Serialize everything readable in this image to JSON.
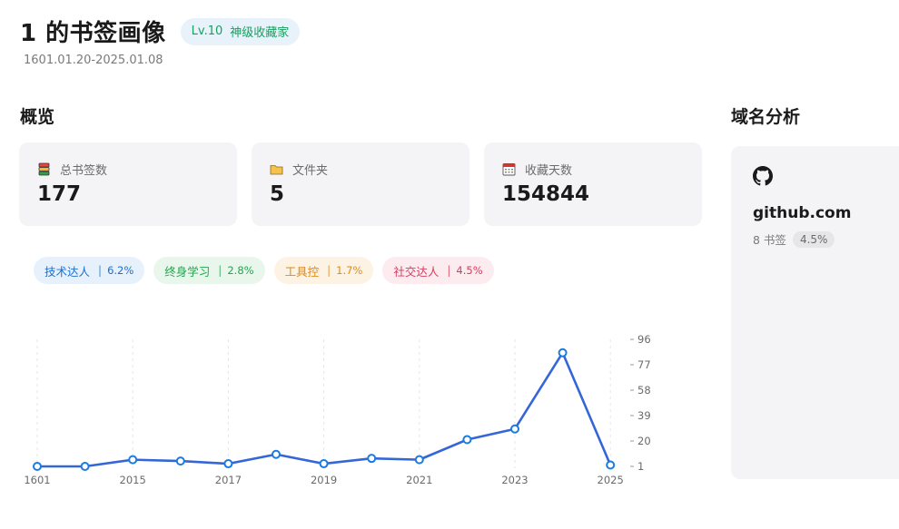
{
  "header": {
    "title": "1 的书签画像",
    "level": "Lv.10",
    "level_title": "神级收藏家",
    "date_range": "1601.01.20-2025.01.08"
  },
  "overview": {
    "title": "概览",
    "cards": [
      {
        "label": "总书签数",
        "value": "177",
        "icon": "bookmark-stack-icon"
      },
      {
        "label": "文件夹",
        "value": "5",
        "icon": "folder-icon"
      },
      {
        "label": "收藏天数",
        "value": "154844",
        "icon": "calendar-icon"
      }
    ]
  },
  "tags": [
    {
      "name": "技术达人",
      "percent": "6.2%",
      "color": "#1a6fd0",
      "bg": "#e7f1fc"
    },
    {
      "name": "终身学习",
      "percent": "2.8%",
      "color": "#25a34e",
      "bg": "#e9f6ec"
    },
    {
      "name": "工具控",
      "percent": "1.7%",
      "color": "#e08a17",
      "bg": "#fdf3e4"
    },
    {
      "name": "社交达人",
      "percent": "4.5%",
      "color": "#d43d5e",
      "bg": "#fcebef"
    }
  ],
  "chart_data": {
    "type": "line",
    "x_tick_labels": [
      "1601",
      "2015",
      "2017",
      "2019",
      "2021",
      "2023",
      "2025"
    ],
    "y_ticks": [
      96,
      77,
      58,
      39,
      20,
      1
    ],
    "ylim": [
      1,
      96
    ],
    "values": [
      1,
      1,
      6,
      5,
      3,
      10,
      3,
      7,
      6,
      21,
      29,
      86,
      2
    ],
    "line_color": "#3566d8",
    "point_fill": "#ffffff",
    "grid": "vertical dashed"
  },
  "domains": {
    "title": "域名分析",
    "items": [
      {
        "domain": "github.com",
        "count_label": "8 书签",
        "percent": "4.5%",
        "icon": "github-icon"
      }
    ]
  }
}
